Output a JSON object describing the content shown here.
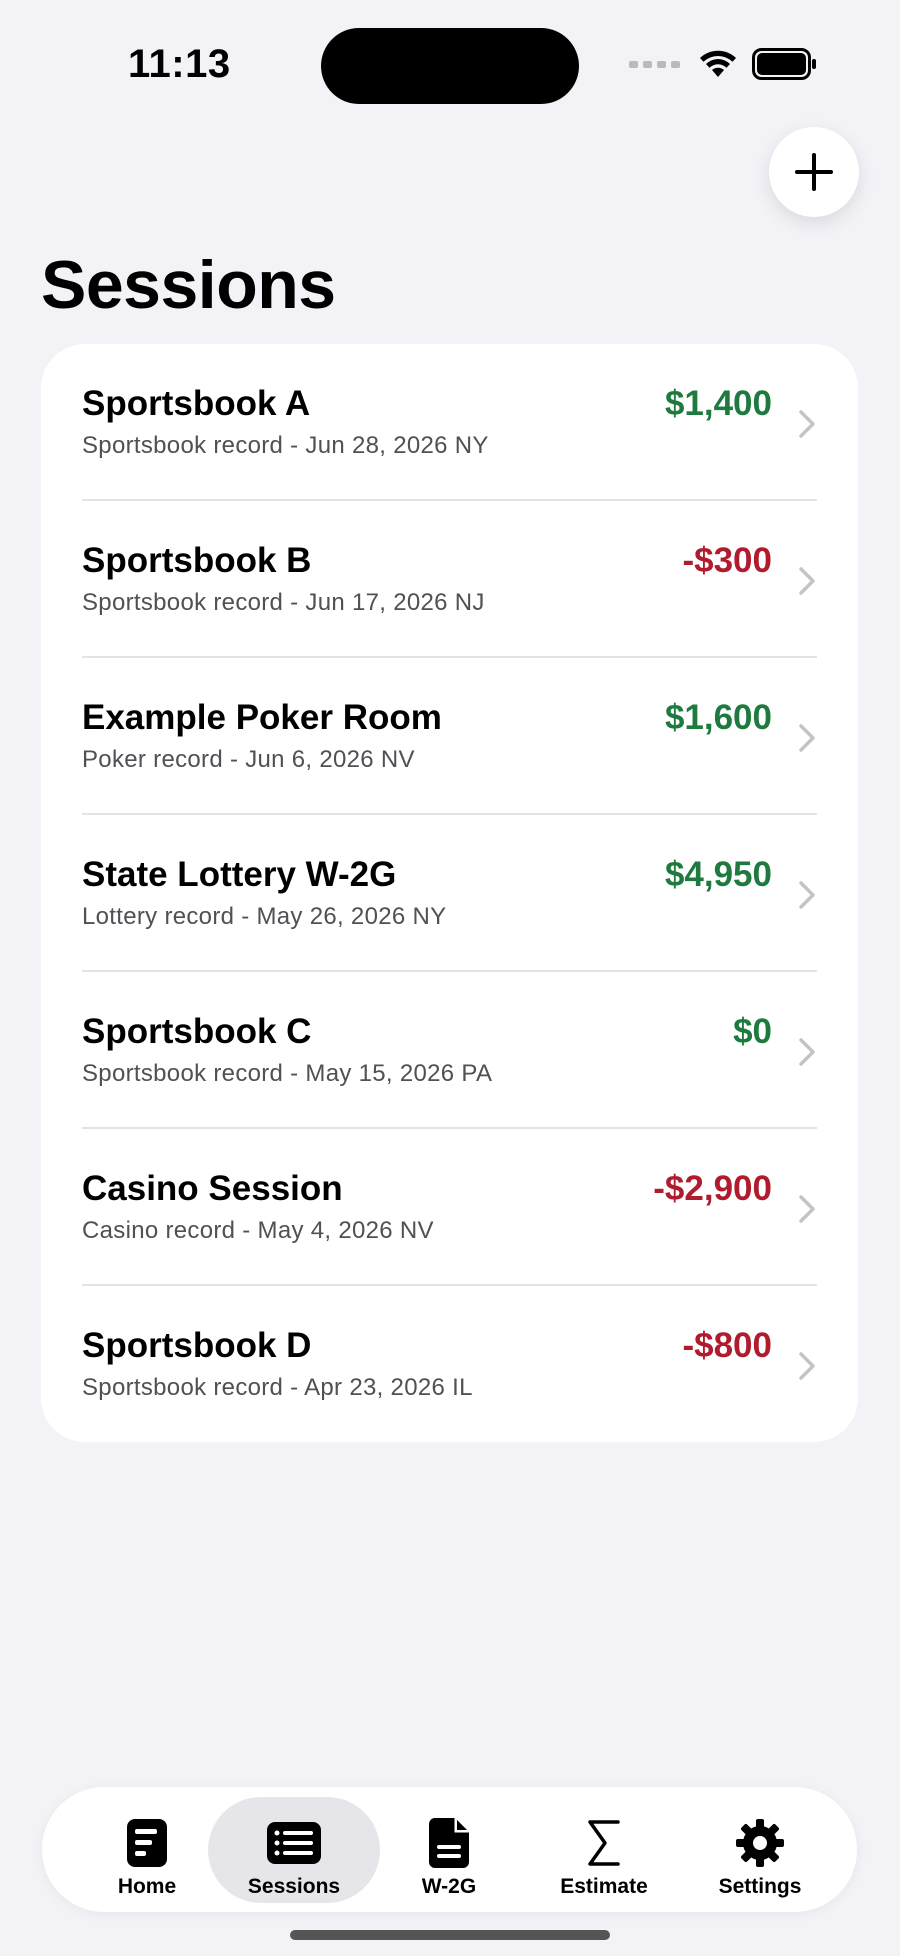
{
  "status_bar": {
    "time": "11:13"
  },
  "header": {
    "title": "Sessions",
    "add_icon": "plus-icon"
  },
  "sessions": [
    {
      "name": "Sportsbook A",
      "subtitle": "Sportsbook record - Jun 28, 2026 NY",
      "amount": "$1,400",
      "sign": "pos"
    },
    {
      "name": "Sportsbook B",
      "subtitle": "Sportsbook record - Jun 17, 2026 NJ",
      "amount": "-$300",
      "sign": "neg"
    },
    {
      "name": "Example Poker Room",
      "subtitle": "Poker record - Jun 6, 2026 NV",
      "amount": "$1,600",
      "sign": "pos"
    },
    {
      "name": "State Lottery W-2G",
      "subtitle": "Lottery record - May 26, 2026 NY",
      "amount": "$4,950",
      "sign": "pos"
    },
    {
      "name": "Sportsbook C",
      "subtitle": "Sportsbook record - May 15, 2026 PA",
      "amount": "$0",
      "sign": "pos"
    },
    {
      "name": "Casino Session",
      "subtitle": "Casino record - May 4, 2026 NV",
      "amount": "-$2,900",
      "sign": "neg"
    },
    {
      "name": "Sportsbook D",
      "subtitle": "Sportsbook record - Apr 23, 2026 IL",
      "amount": "-$800",
      "sign": "neg"
    }
  ],
  "tabs": [
    {
      "label": "Home",
      "icon": "home-document-icon",
      "active": false
    },
    {
      "label": "Sessions",
      "icon": "list-icon",
      "active": true
    },
    {
      "label": "W-2G",
      "icon": "document-icon",
      "active": false
    },
    {
      "label": "Estimate",
      "icon": "sigma-icon",
      "active": false
    },
    {
      "label": "Settings",
      "icon": "gear-icon",
      "active": false
    }
  ],
  "colors": {
    "positive": "#1e7a3e",
    "negative": "#b11b2e",
    "background": "#f2f2f7"
  }
}
